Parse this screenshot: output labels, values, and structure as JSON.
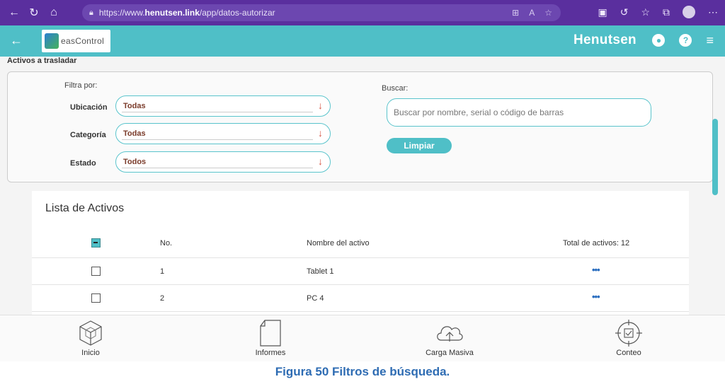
{
  "browser": {
    "url_prefix": "https://www.",
    "url_domain": "henutsen.link",
    "url_path": "/app/datos-autorizar"
  },
  "header": {
    "logo_text": "easControl",
    "brand": "Henutsen"
  },
  "section_title": "Activos a trasladar",
  "filters": {
    "filter_by_label": "Filtra por:",
    "rows": [
      {
        "label": "Ubicación",
        "value": "Todas"
      },
      {
        "label": "Categoría",
        "value": "Todas"
      },
      {
        "label": "Estado",
        "value": "Todos"
      }
    ],
    "search_label": "Buscar:",
    "search_placeholder": "Buscar por nombre, serial o código de barras",
    "clear_button": "Limpiar"
  },
  "list": {
    "title": "Lista de Activos",
    "columns": {
      "no": "No.",
      "name": "Nombre del activo",
      "total": "Total de activos: 12"
    },
    "rows": [
      {
        "no": "1",
        "name": "Tablet 1"
      },
      {
        "no": "2",
        "name": "PC 4"
      }
    ]
  },
  "bottom_nav": [
    {
      "label": "Inicio",
      "icon": "cube-icon"
    },
    {
      "label": "Informes",
      "icon": "document-icon"
    },
    {
      "label": "Carga Masiva",
      "icon": "cloud-upload-icon"
    },
    {
      "label": "Conteo",
      "icon": "crosshair-check-icon"
    }
  ],
  "caption": "Figura 50 Filtros de búsqueda.",
  "colors": {
    "accent": "#4fbfc7",
    "browser": "#5a2f9e",
    "caption": "#2e6cb3"
  }
}
